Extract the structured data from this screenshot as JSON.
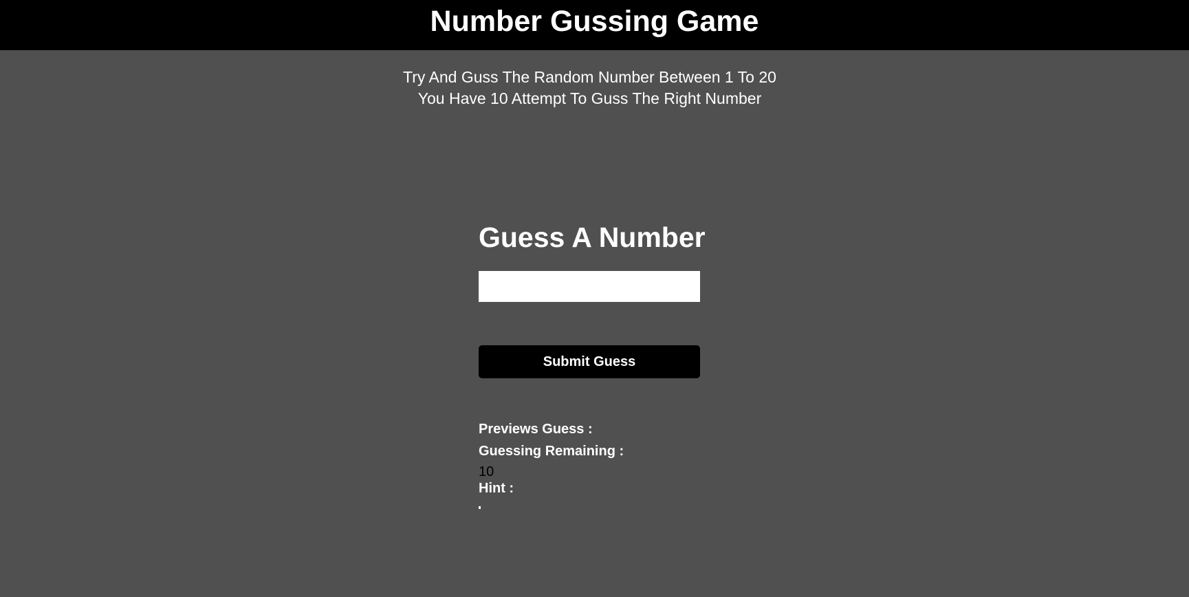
{
  "header": {
    "title": "Number Gussing Game"
  },
  "intro": {
    "line1": "Try And Guss The Random Number Between 1 To 20",
    "line2": "You Have 10 Attempt To Guss The Right Number"
  },
  "form": {
    "heading": "Guess A Number",
    "input_value": "",
    "input_placeholder": "",
    "submit_label": "Submit Guess"
  },
  "results": {
    "previous_label": "Previews Guess :",
    "previous_value": "",
    "remaining_label": "Guessing Remaining :",
    "remaining_value": "10",
    "hint_label": "Hint :",
    "hint_value": ""
  },
  "colors": {
    "background": "#505050",
    "header_bg": "#000000",
    "button_bg": "#000000",
    "text": "#ffffff"
  }
}
